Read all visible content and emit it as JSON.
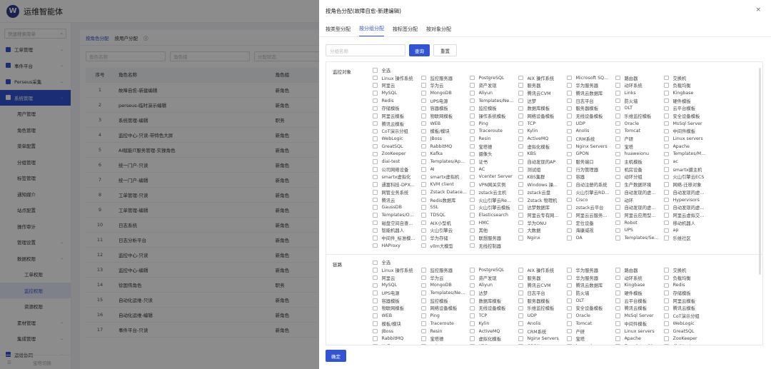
{
  "app": {
    "title": "运维智能体",
    "logo_letter": "W"
  },
  "sidebar": {
    "search_placeholder": "快速搜索菜单",
    "items": [
      {
        "label": "工单管理",
        "level": 0,
        "icon": "ticket-icon"
      },
      {
        "label": "事件平台",
        "level": 0,
        "icon": "event-icon"
      },
      {
        "label": "Perseus采集",
        "level": 0,
        "icon": "diamond-icon"
      },
      {
        "label": "系统管理",
        "level": 0,
        "icon": "gear-icon",
        "active": true
      },
      {
        "label": "用户管理",
        "level": 1
      },
      {
        "label": "角色管理",
        "level": 1
      },
      {
        "label": "菜单配置",
        "level": 1
      },
      {
        "label": "分组管理",
        "level": 1
      },
      {
        "label": "标签管理",
        "level": 1
      },
      {
        "label": "通知媒介",
        "level": 1
      },
      {
        "label": "站点配置",
        "level": 1
      },
      {
        "label": "操作审计",
        "level": 1
      },
      {
        "label": "管理设置",
        "level": 1
      },
      {
        "label": "数据权限",
        "level": 1
      },
      {
        "label": "工单权限",
        "level": 2
      },
      {
        "label": "监控权限",
        "level": 2,
        "active": true
      },
      {
        "label": "资源权限",
        "level": 2
      },
      {
        "label": "素材管理",
        "level": 1
      },
      {
        "label": "集成管理",
        "level": 1
      },
      {
        "label": "运维协同",
        "level": 0,
        "icon": "collab-icon"
      }
    ],
    "bottom": "宝塔切换"
  },
  "main": {
    "tabs": [
      "按角色分配",
      "按用户分配"
    ],
    "filters": [
      "角色名称",
      "角色组",
      "分配状态"
    ],
    "table": {
      "headers": [
        "序号",
        "角色名称",
        "角色组"
      ],
      "rows": [
        [
          "1",
          "故障自愈-新建编辑",
          "新角色"
        ],
        [
          "2",
          "perseus-临时演示编辑",
          "新角色"
        ],
        [
          "3",
          "系统管理-编辑",
          "职务"
        ],
        [
          "4",
          "监控中心-只读-带特色大屏",
          "新角色"
        ],
        [
          "5",
          "AI赋能IT服务管理-实操角色",
          "新角色"
        ],
        [
          "6",
          "统一门户-只读",
          "新角色"
        ],
        [
          "7",
          "统一门户-编辑",
          "新角色"
        ],
        [
          "8",
          "工单管理-只读",
          "新角色"
        ],
        [
          "9",
          "工单管理-编辑",
          "新角色"
        ],
        [
          "10",
          "日志系统",
          "新角色"
        ],
        [
          "11",
          "日志分析平台",
          "新角色"
        ],
        [
          "12",
          "监控中心-只读",
          "新角色"
        ],
        [
          "13",
          "监控中心-编辑",
          "新角色"
        ],
        [
          "14",
          "徐国伟角色",
          "职务"
        ],
        [
          "15",
          "自动化运维-只读",
          "新角色"
        ],
        [
          "16",
          "自动化运维-编辑",
          "新角色"
        ],
        [
          "17",
          "事件平台-只读",
          "新角色"
        ]
      ]
    }
  },
  "dialog": {
    "title": "按角色分配(故障自愈-新建编辑)",
    "close": "×",
    "tabs": [
      "按类型分配",
      "按分组分配",
      "按标签分配",
      "按对象分配"
    ],
    "active_tab": 1,
    "search_placeholder": "分组名称",
    "query_btn": "查询",
    "reset_btn": "重置",
    "ok_btn": "确定",
    "groups": [
      {
        "title": "监控对象",
        "items": [
          "全选",
          "Linux 操作系统",
          "监控服务器",
          "PostgreSQL",
          "AIX 操作系统",
          "Microsoft SQ...",
          "路由器",
          "交换机",
          "阿里云",
          "华为云",
          "资产发现",
          "服务器",
          "华为服务器",
          "动环系统",
          "负载均衡",
          "MySQL",
          "MongoDB",
          "Aliyun",
          "腾讯云CVM",
          "腾讯云数据库",
          "Links",
          "Kingbase",
          "Redis",
          "UPS电源",
          "Templates/Ne...",
          "达梦",
          "日志平台",
          "防火墙",
          "硬件模板",
          "存储模板",
          "容器模板",
          "监控模板",
          "数据库模板",
          "服务器模板",
          "OLT",
          "云平台模板",
          "阿里云模板",
          "物联网模板",
          "操作系统模板",
          "网络设备模板",
          "无线设备模板",
          "乐维监控模板",
          "安全设备模板",
          "腾讯云模板",
          "WEB",
          "Ping",
          "TCP",
          "UDP",
          "Oracle",
          "MsSql Server",
          "CoT演示分组",
          "模板/模块",
          "Traceroute",
          "Kylin",
          "Anolis",
          "Tomcat",
          "中间件模板",
          "WebLogic",
          "JBoss",
          "Resin",
          "ActiveMQ",
          "CRM系统",
          "产研",
          "Linux servers",
          "GreatSQL",
          "RabbitMQ",
          "宝塔德",
          "虚拟化模板",
          "Nginx Servers",
          "宝塔",
          "Apache",
          "ZooKeeper",
          "Kafka",
          "摄像头",
          "KBS",
          "GPON",
          "huaweionu",
          "Templates/M...",
          "dial-test",
          "Templates/Ap...",
          "证书",
          "自动发现的AP",
          "服务端口",
          "主机模板",
          "ac",
          "公司网络设备",
          "AI",
          "AC",
          "测试组",
          "行为管理器",
          "机房设备",
          "smartx摄主机",
          "smartx虚拟化",
          "smartx虚拟机",
          "Vcenter Server",
          "KBS集群",
          "容器",
          "动环分组",
          "火山引擎云ECS",
          "通富科技-DPX...",
          "KVM client",
          "VPN网关实例",
          "Windows 操...",
          "自动注册的系统",
          "生产数据环境",
          "网络-迁移对象",
          "网管业务系统",
          "Zstack Datace...",
          "zstack云主机",
          "zstack云盘",
          "火山引擎云RD...",
          "自动发现的虚...",
          "自动发现的虚...",
          "腾讯云",
          "Redis数据库",
          "火山引擎云Re...",
          "Zstack 物理机",
          "Cisco",
          "动环",
          "Hypervisors",
          "GaussDB",
          "SSL",
          "火山引擎云模板",
          "达梦数据库",
          "zstack云平台",
          "自动发现的虚...",
          "自动发现的虚...",
          "Templates/O...",
          "TDSQL",
          "Elasticsearch",
          "阿里云专有网...",
          "阿里云云服务...",
          "阿里云应用型...",
          "阿里云虚拟交...",
          "磁盘空间自查...",
          "AIX小型机",
          "HMC",
          "华为ONU",
          "定位设备",
          "Robot",
          "移动机器人",
          "智能机器人",
          "火山引擎云",
          "其他",
          "大数据",
          "海康威视",
          "UPS",
          "ap",
          "中间件_标准模...",
          "华为存储",
          "联想服务器",
          "Nginx",
          "OA",
          "Templates/Se...",
          "乐维社区",
          "HAProxy",
          "vllm大模型",
          "无线控制器"
        ]
      },
      {
        "title": "链路",
        "items": [
          "全选",
          "Linux 操作系统",
          "监控服务器",
          "PostgreSQL",
          "AIX 操作系统",
          "华为服务器",
          "路由器",
          "交换机",
          "阿里云",
          "华为云",
          "资产发现",
          "服务器",
          "华为服务器",
          "动环系统",
          "负载均衡",
          "MySQL",
          "MongoDB",
          "Aliyun",
          "腾讯云CVM",
          "腾讯云数据库",
          "Kingbase",
          "Redis",
          "UPS电源",
          "Templates/Ne...",
          "达梦",
          "日志平台",
          "防火墙",
          "硬件模板",
          "存储模板",
          "容器模板",
          "监控模板",
          "数据库模板",
          "服务器模板",
          "OLT",
          "云平台模板",
          "阿里云模板",
          "物联网模板",
          "网络设备模板",
          "无线设备模板",
          "乐维监控模板",
          "安全设备模板",
          "腾讯云模板",
          "腾讯云模板",
          "WEB",
          "Ping",
          "TCP",
          "UDP",
          "Oracle",
          "MsSql Server",
          "CoT演示分组",
          "模板/模块",
          "Traceroute",
          "Kylin",
          "Anolis",
          "Tomcat",
          "中间件模板",
          "WebLogic",
          "JBoss",
          "Resin",
          "ActiveMQ",
          "CRM系统",
          "产研",
          "Linux servers",
          "GreatSQL",
          "RabbitMQ",
          "宝塔德",
          "虚拟化模板",
          "Nginx Servers",
          "宝塔",
          "Apache",
          "ZooKeeper",
          "Kafka",
          "摄像头",
          "KBS",
          "GPON",
          "huaweionu",
          "Templates/M...",
          "dial-test"
        ]
      }
    ]
  },
  "colors": {
    "accent": "#3354d1",
    "overlay": "rgba(0,0,0,0.45)"
  }
}
